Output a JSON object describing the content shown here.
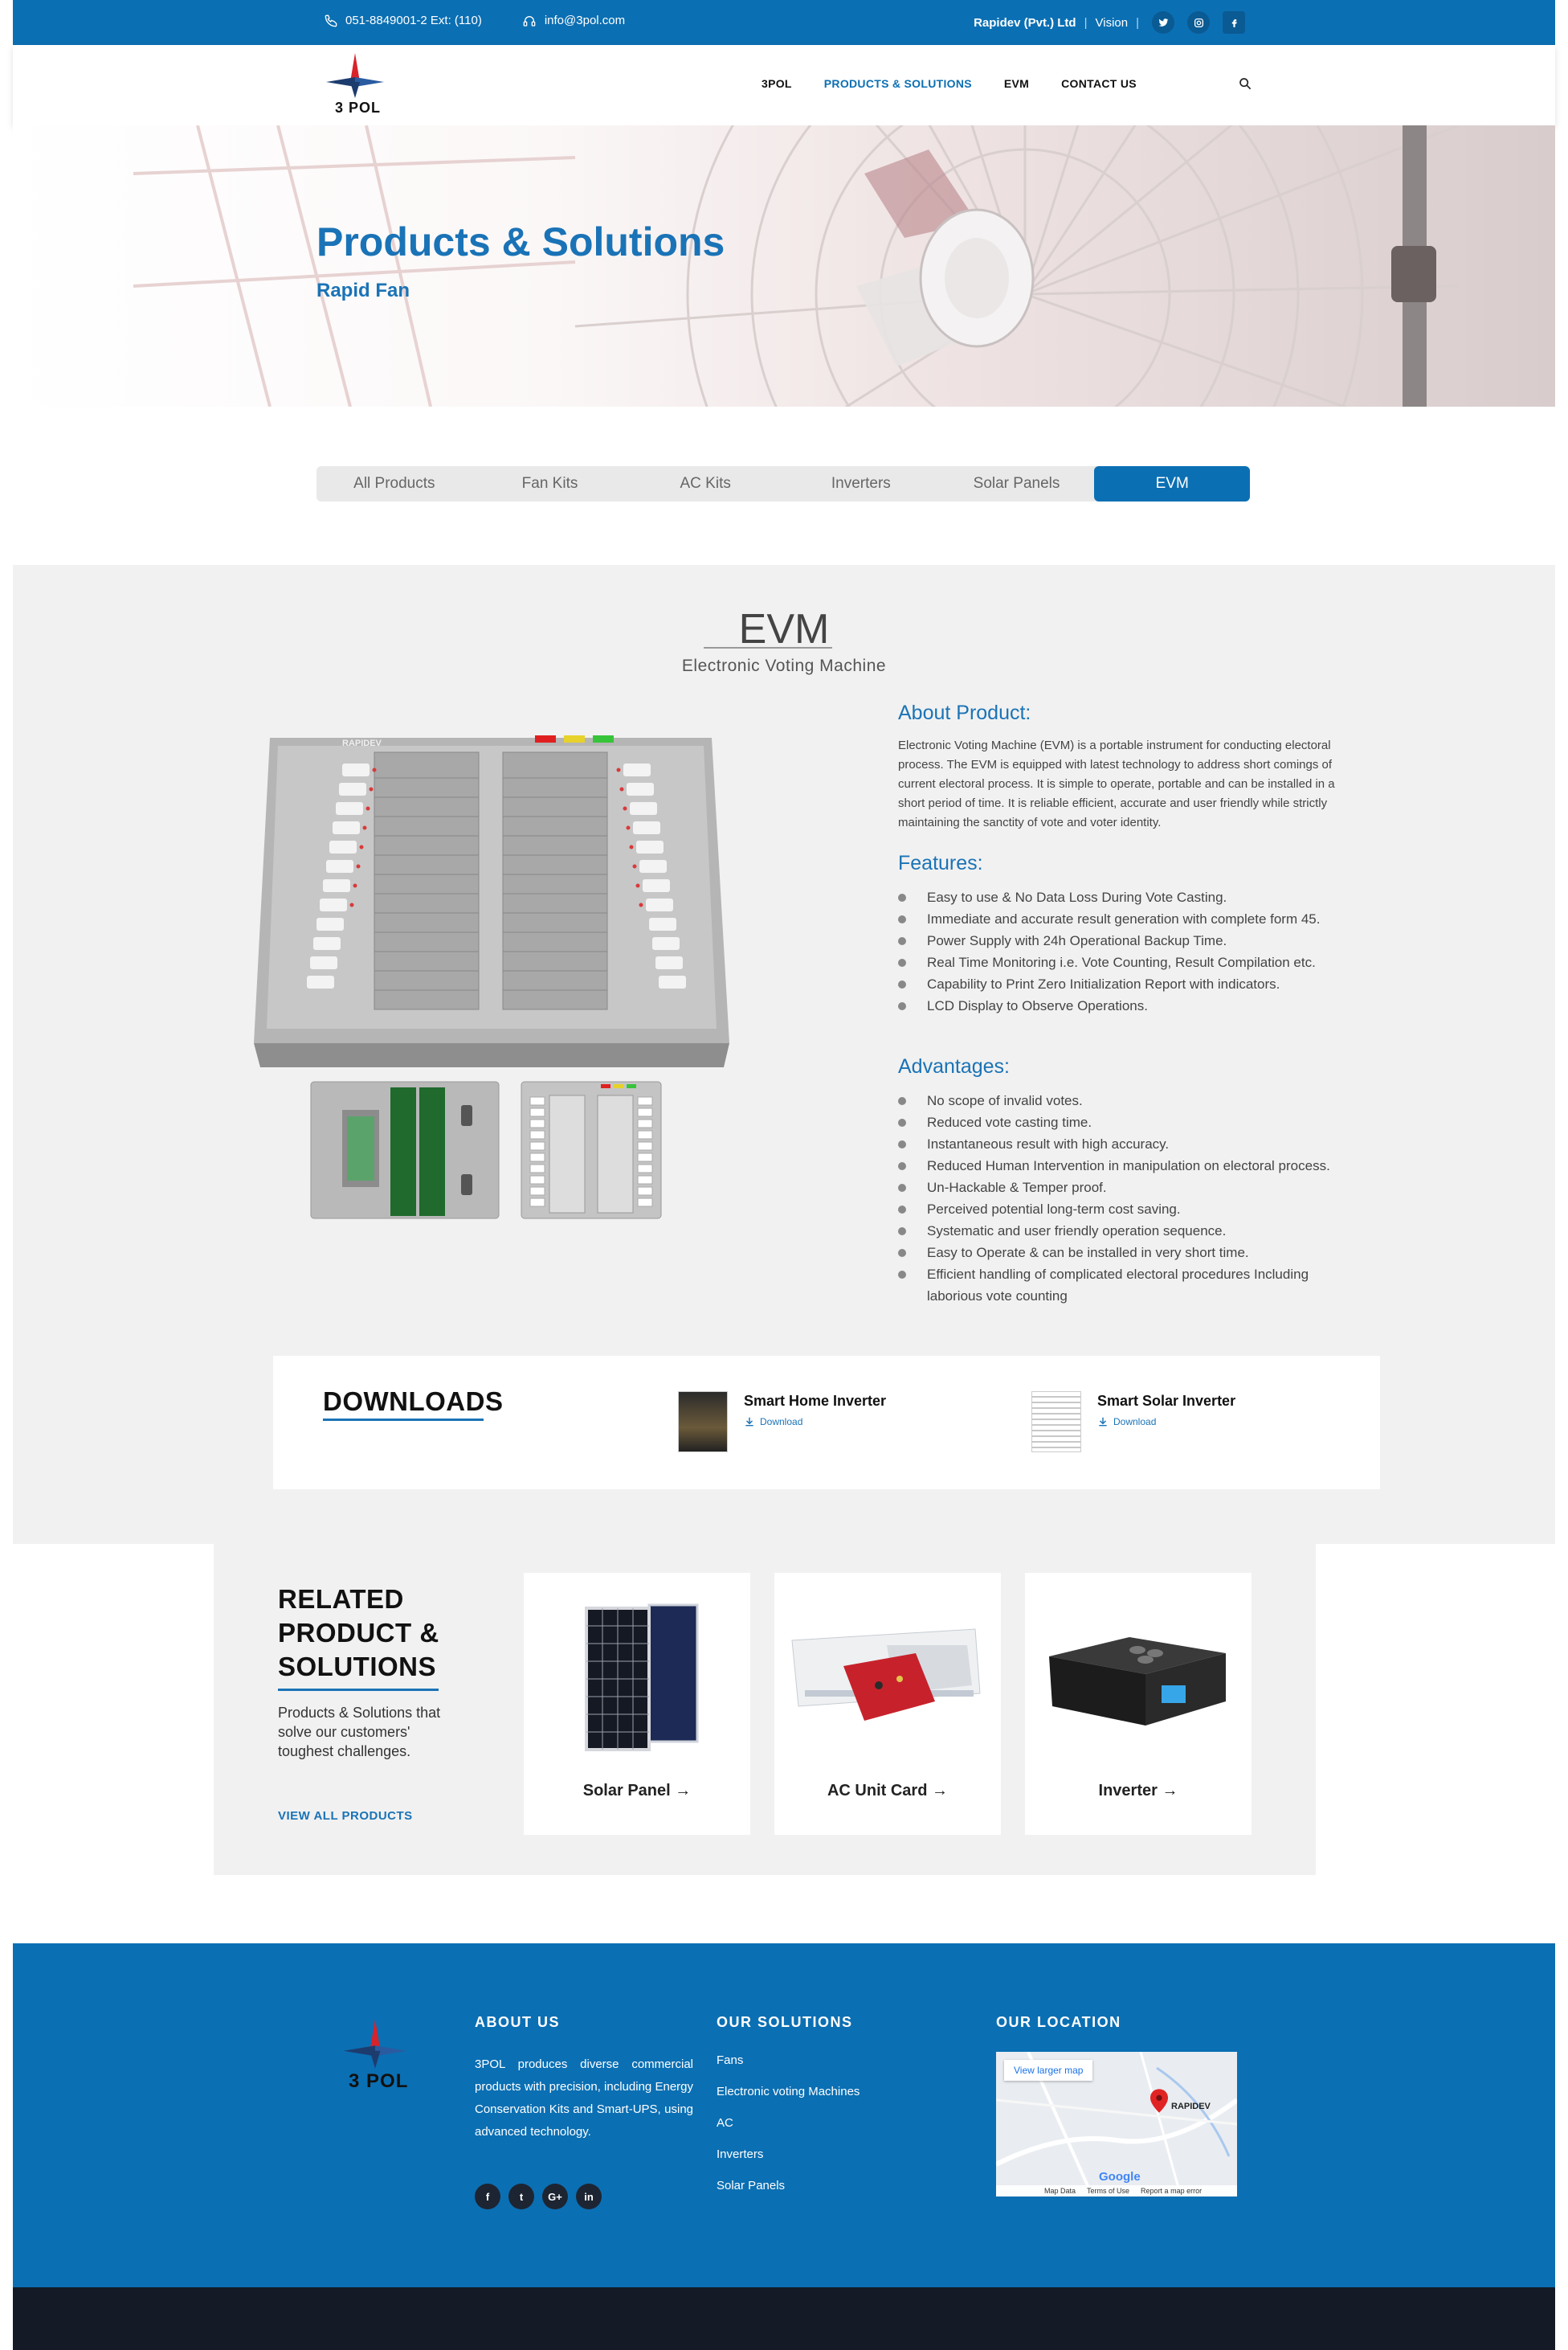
{
  "topbar": {
    "phone": "051-8849001-2 Ext: (110)",
    "email": "info@3pol.com",
    "company": "Rapidev (Pvt.) Ltd",
    "vision": "Vision",
    "separator": "|",
    "social": [
      "twitter-icon",
      "instagram-icon",
      "facebook-icon"
    ]
  },
  "nav": {
    "logo_text": "3 POL",
    "menu": [
      "3POL",
      "PRODUCTS & SOLUTIONS",
      "EVM",
      "CONTACT US"
    ],
    "active_index": 1
  },
  "hero": {
    "title": "Products & Solutions",
    "subtitle": "Rapid Fan"
  },
  "tabs": {
    "items": [
      "All Products",
      "Fan Kits",
      "AC Kits",
      "Inverters",
      "Solar Panels",
      "EVM"
    ],
    "active_index": 5
  },
  "product": {
    "title": "EVM",
    "subtitle": "Electronic Voting  Machine",
    "about_heading": "About Product:",
    "about_text": "Electronic Voting Machine (EVM) is a portable instrument for conducting electoral process. The EVM is equipped with latest technology to address short comings of current electoral process. It is simple to operate, portable and can be installed in a short period of time. It is reliable efficient, accurate and user friendly while strictly maintaining the sanctity of vote and voter identity.",
    "features_heading": "Features:",
    "features": [
      "Easy to use & No Data Loss During Vote Casting.",
      "Immediate and accurate result generation with complete form 45.",
      "Power Supply with 24h Operational Backup Time.",
      "Real Time Monitoring i.e. Vote Counting, Result Compilation etc.",
      "Capability to Print Zero Initialization Report with indicators.",
      "LCD Display to Observe Operations."
    ],
    "advantages_heading": "Advantages:",
    "advantages": [
      "No scope of invalid votes.",
      "Reduced vote casting time.",
      "Instantaneous result with high accuracy.",
      "Reduced Human Intervention in manipulation on electoral process.",
      "Un-Hackable & Temper proof.",
      "Perceived potential long-term cost saving.",
      "Systematic and user friendly operation sequence.",
      "Easy to Operate & can be installed in very short time.",
      "Efficient handling of complicated electoral procedures Including laborious vote counting"
    ],
    "device_brand": "RAPIDEV"
  },
  "downloads": {
    "title": "DOWNLOADS",
    "items": [
      {
        "name": "Smart Home Inverter",
        "link": "Download"
      },
      {
        "name": "Smart Solar Inverter",
        "link": "Download"
      }
    ]
  },
  "related": {
    "title_lines": [
      "RELATED",
      "PRODUCT &",
      "SOLUTIONS"
    ],
    "description": "Products & Solutions that solve our customers' toughest challenges.",
    "link": "VIEW ALL PRODUCTS",
    "cards": [
      {
        "name": "Solar Panel"
      },
      {
        "name": "AC Unit Card"
      },
      {
        "name": "Inverter"
      }
    ]
  },
  "footer": {
    "logo_text": "3 POL",
    "about_heading": "ABOUT US",
    "about_text": "3POL produces diverse commercial products with precision, including Energy Conservation Kits and Smart-UPS, using advanced technology.",
    "social": [
      "f",
      "t",
      "G+",
      "in"
    ],
    "solutions_heading": "OUR SOLUTIONS",
    "solutions": [
      "Fans",
      "Electronic voting Machines",
      "AC",
      "Inverters",
      "Solar Panels"
    ],
    "location_heading": "OUR LOCATION",
    "map": {
      "larger_link": "View larger map",
      "place": "RAPIDEV",
      "google": "Google",
      "bar": [
        "Map Data",
        "Terms of Use",
        "Report a map error"
      ]
    }
  },
  "colors": {
    "brand_blue": "#0b6fb3",
    "section_gray": "#f1f1f1",
    "footer_dark": "#141b26"
  }
}
